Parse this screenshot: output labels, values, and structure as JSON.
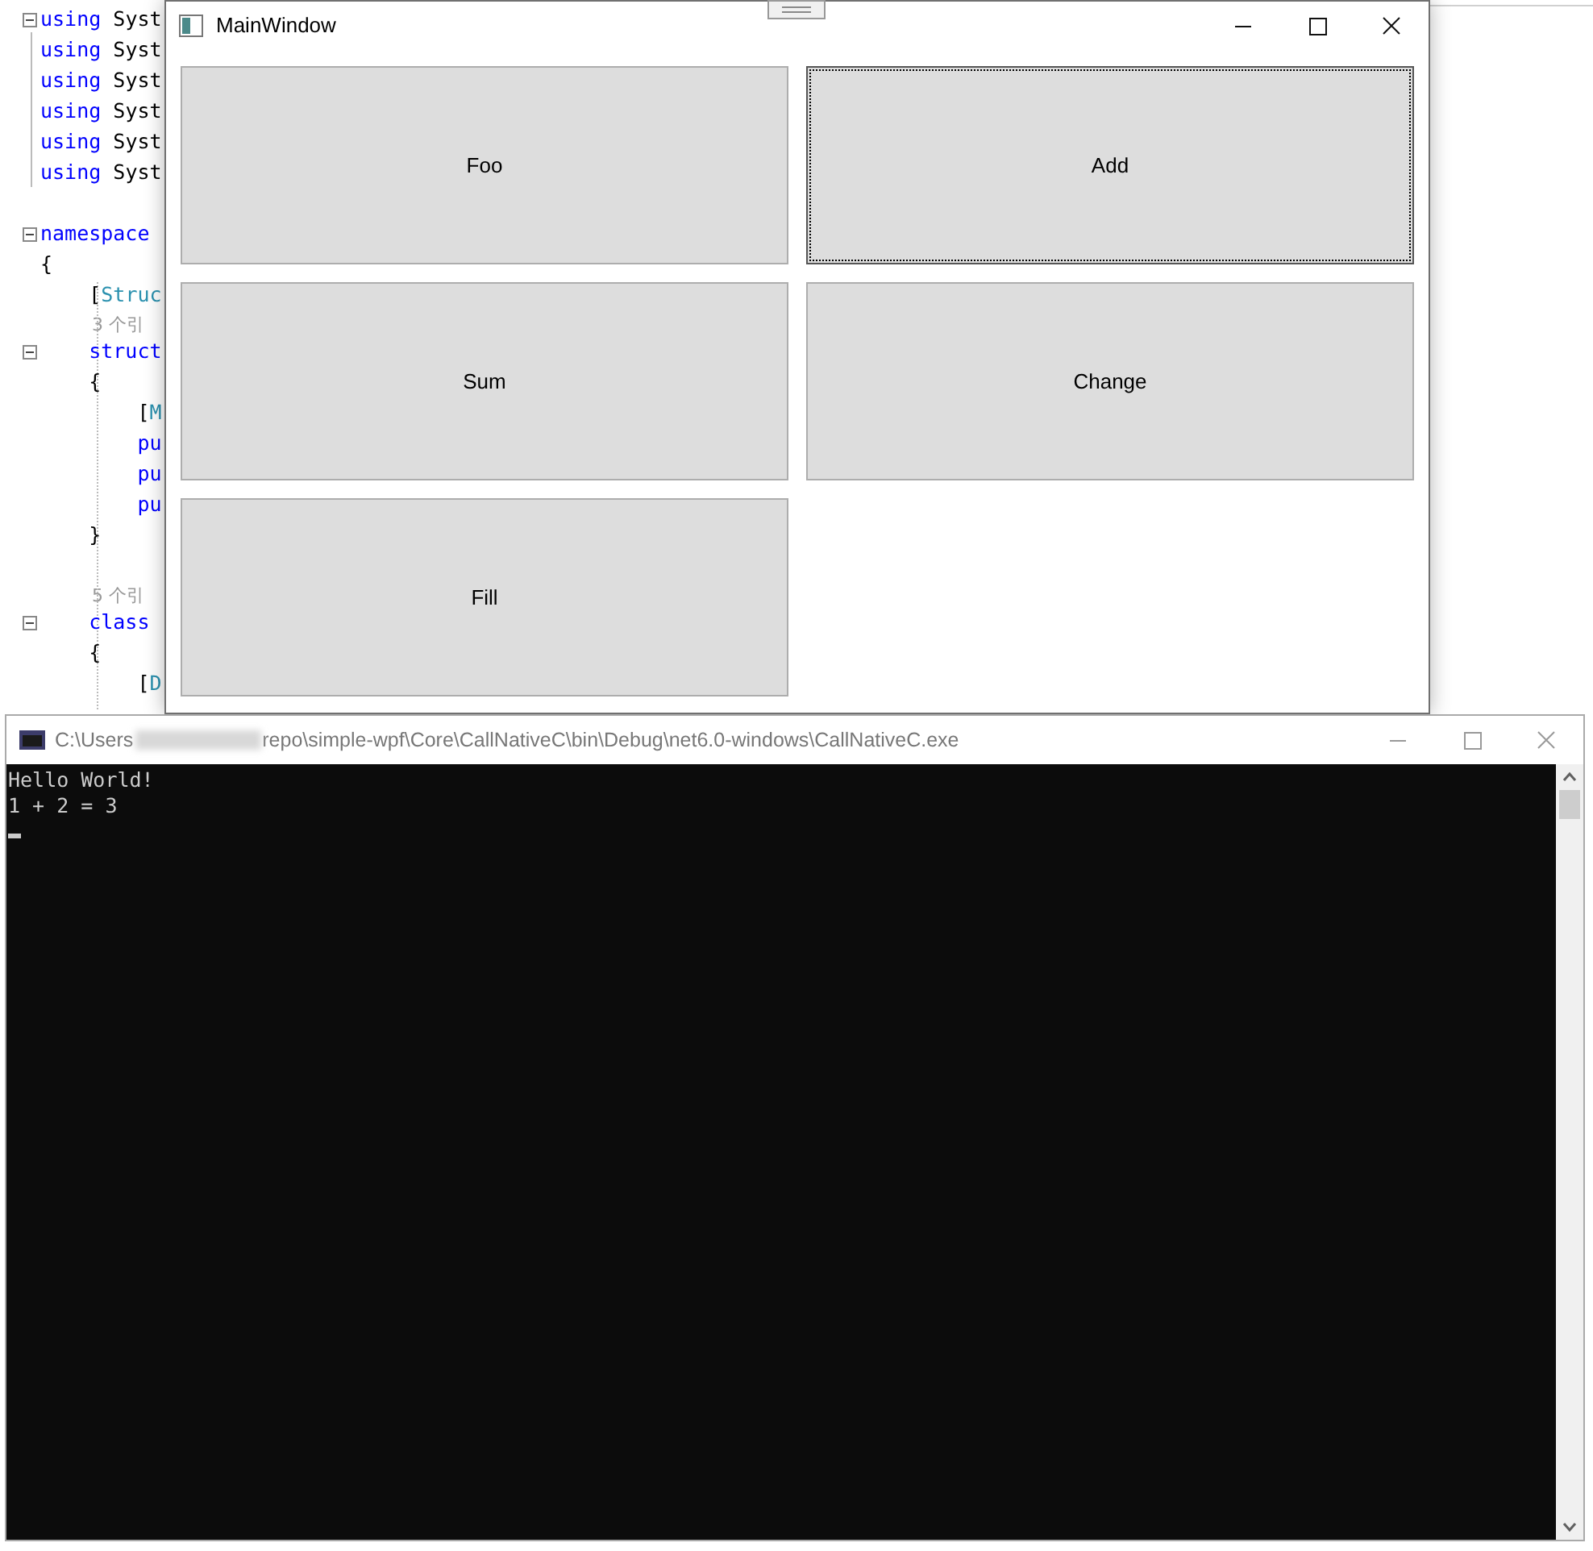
{
  "editor": {
    "lines": [
      {
        "kind": "code",
        "fold": true,
        "segments": [
          {
            "kind": "keyword",
            "text": "using"
          },
          {
            "kind": "plain",
            "text": " Syst"
          }
        ]
      },
      {
        "kind": "code",
        "fold": false,
        "segments": [
          {
            "kind": "keyword",
            "text": "using"
          },
          {
            "kind": "plain",
            "text": " Syst"
          }
        ]
      },
      {
        "kind": "code",
        "fold": false,
        "segments": [
          {
            "kind": "keyword",
            "text": "using"
          },
          {
            "kind": "plain",
            "text": " Syst"
          }
        ]
      },
      {
        "kind": "code",
        "fold": false,
        "segments": [
          {
            "kind": "keyword",
            "text": "using"
          },
          {
            "kind": "plain",
            "text": " Syst"
          }
        ]
      },
      {
        "kind": "code",
        "fold": false,
        "segments": [
          {
            "kind": "keyword",
            "text": "using"
          },
          {
            "kind": "plain",
            "text": " Syst"
          }
        ]
      },
      {
        "kind": "code",
        "fold": false,
        "segments": [
          {
            "kind": "keyword",
            "text": "using"
          },
          {
            "kind": "plain",
            "text": " Syst"
          }
        ]
      },
      {
        "kind": "blank"
      },
      {
        "kind": "code",
        "fold": true,
        "segments": [
          {
            "kind": "keyword",
            "text": "namespace"
          }
        ]
      },
      {
        "kind": "code",
        "fold": false,
        "segments": [
          {
            "kind": "plain",
            "text": "{"
          }
        ]
      },
      {
        "kind": "code",
        "fold": false,
        "segments": [
          {
            "kind": "plain",
            "text": "    ["
          },
          {
            "kind": "type",
            "text": "Struc"
          }
        ]
      },
      {
        "kind": "lens",
        "text": "3 个引"
      },
      {
        "kind": "code",
        "fold": true,
        "segments": [
          {
            "kind": "keyword",
            "text": "    struct"
          }
        ]
      },
      {
        "kind": "code",
        "fold": false,
        "segments": [
          {
            "kind": "plain",
            "text": "    {"
          }
        ]
      },
      {
        "kind": "code",
        "fold": false,
        "segments": [
          {
            "kind": "plain",
            "text": "        ["
          },
          {
            "kind": "type",
            "text": "M"
          }
        ]
      },
      {
        "kind": "code",
        "fold": false,
        "segments": [
          {
            "kind": "keyword",
            "text": "        pu"
          }
        ]
      },
      {
        "kind": "code",
        "fold": false,
        "segments": [
          {
            "kind": "keyword",
            "text": "        pu"
          }
        ]
      },
      {
        "kind": "code",
        "fold": false,
        "segments": [
          {
            "kind": "keyword",
            "text": "        pu"
          }
        ]
      },
      {
        "kind": "code",
        "fold": false,
        "segments": [
          {
            "kind": "plain",
            "text": "    }"
          }
        ]
      },
      {
        "kind": "blank"
      },
      {
        "kind": "lens",
        "text": "5 个引"
      },
      {
        "kind": "code",
        "fold": true,
        "segments": [
          {
            "kind": "keyword",
            "text": "    class"
          }
        ]
      },
      {
        "kind": "code",
        "fold": false,
        "segments": [
          {
            "kind": "plain",
            "text": "    {"
          }
        ]
      },
      {
        "kind": "code",
        "fold": false,
        "segments": [
          {
            "kind": "plain",
            "text": "        ["
          },
          {
            "kind": "type",
            "text": "D"
          }
        ]
      }
    ]
  },
  "main_window": {
    "title": "MainWindow",
    "buttons": [
      {
        "label": "Foo",
        "focused": false
      },
      {
        "label": "Add",
        "focused": true
      },
      {
        "label": "Sum",
        "focused": false
      },
      {
        "label": "Change",
        "focused": false
      },
      {
        "label": "Fill",
        "focused": false
      }
    ]
  },
  "console": {
    "title_start": "C:\\Users",
    "title_end": "repo\\simple-wpf\\Core\\CallNativeC\\bin\\Debug\\net6.0-windows\\CallNativeC.exe",
    "lines": [
      "Hello World!",
      "1 + 2 = 3"
    ]
  }
}
